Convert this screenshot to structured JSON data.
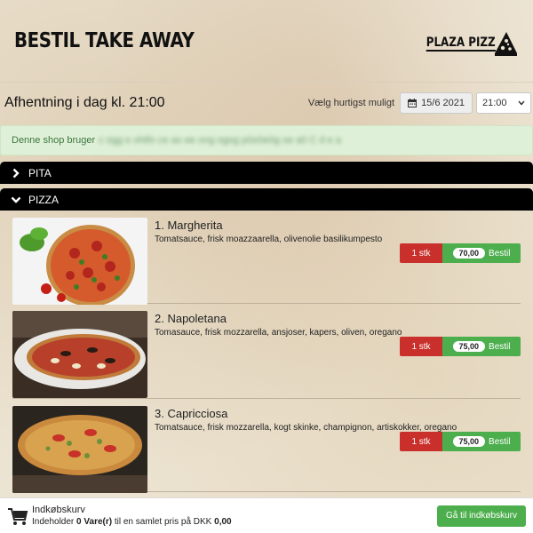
{
  "header": {
    "title": "BESTIL TAKE AWAY",
    "logo_text": "PLAZA PIZZ"
  },
  "pickup": {
    "title": "Afhentning i dag kl. 21:00",
    "label": "Vælg hurtigst muligt",
    "date": "15/6 2021",
    "time": "21:00"
  },
  "alert": {
    "text": "Denne shop bruger",
    "blurred_text": "c ogg e ohtfo ce ao ee ong ogog p0o0e0g oe a0 C d e a"
  },
  "categories": [
    {
      "label": "PITA",
      "expanded": false
    },
    {
      "label": "PIZZA",
      "expanded": true
    }
  ],
  "products": [
    {
      "name": "1. Margherita",
      "description": "Tomatsauce, frisk moazzaarella, olivenolie basilikumpesto",
      "qty": "1 stk",
      "price": "70,00",
      "order_label": "Bestil"
    },
    {
      "name": "2. Napoletana",
      "description": "Tomasauce, frisk mozzarella, ansjoser, kapers, oliven, oregano",
      "qty": "1 stk",
      "price": "75,00",
      "order_label": "Bestil"
    },
    {
      "name": "3. Capricciosa",
      "description": "Tomatsauce, frisk mozzarella, kogt skinke, champignon, artiskokker, oregano",
      "qty": "1 stk",
      "price": "75,00",
      "order_label": "Bestil"
    }
  ],
  "cart": {
    "title": "Indkøbskurv",
    "prefix": "Indeholder",
    "count": "0 Vare(r)",
    "middle": "til en samlet pris på DKK",
    "total": "0,00",
    "checkout_label": "Gå til indkøbskurv"
  },
  "colors": {
    "category_bg": "#000000",
    "qty_button": "#c9302c",
    "order_button": "#4cae4c",
    "alert_bg": "#dff0d8",
    "alert_text": "#3c763d"
  }
}
